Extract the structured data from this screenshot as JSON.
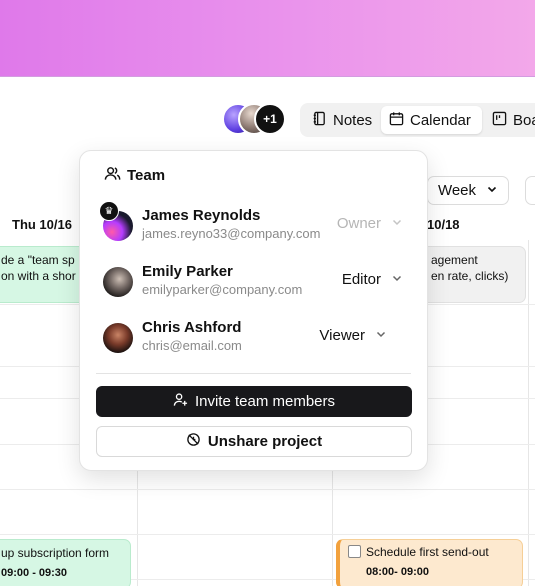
{
  "toolbar": {
    "avatars_extra_count": "+1",
    "views": [
      {
        "label": "Notes",
        "icon": "notebook-icon"
      },
      {
        "label": "Calendar",
        "icon": "calendar-icon",
        "active": true
      },
      {
        "label": "Boa",
        "icon": "board-icon"
      }
    ],
    "week_selector": "Week"
  },
  "calendar": {
    "day_headers": [
      "Thu 10/16",
      "10/18"
    ],
    "events": [
      {
        "line1": "de a \"team sp",
        "line2": "on with a shor"
      },
      {
        "line1": "agement",
        "line2": "en rate, clicks)"
      },
      {
        "line1": "up subscription form",
        "time": "09:00 - 09:30"
      },
      {
        "title": "Schedule first send-out",
        "time": "08:00- 09:00"
      }
    ]
  },
  "team_popover": {
    "title": "Team",
    "members": [
      {
        "name": "James Reynolds",
        "email": "james.reyno33@company.com",
        "role": "Owner",
        "is_owner": true
      },
      {
        "name": "Emily Parker",
        "email": "emilyparker@company.com",
        "role": "Editor"
      },
      {
        "name": "Chris Ashford",
        "email": "chris@email.com",
        "role": "Viewer"
      }
    ],
    "invite_label": "Invite team members",
    "unshare_label": "Unshare project"
  },
  "colors": {
    "banner_start": "#df79ea",
    "banner_end": "#f3a8ea",
    "green_event": "#d6f7e4",
    "orange_event": "#fde9cf",
    "dark_button": "#18181b"
  }
}
